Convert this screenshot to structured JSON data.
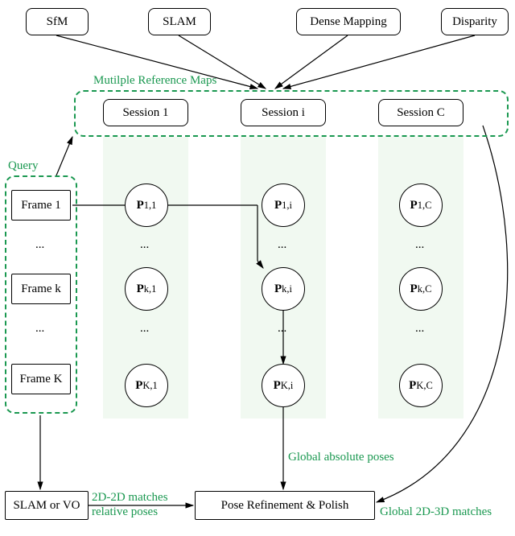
{
  "top": {
    "sfm": "SfM",
    "slam": "SLAM",
    "dense": "Dense Mapping",
    "disparity": "Disparity"
  },
  "refmaps_label": "Mutilple Reference Maps",
  "sessions": {
    "s1": "Session 1",
    "si": "Session i",
    "sc": "Session C"
  },
  "query_label": "Query",
  "frames": {
    "f1": "Frame 1",
    "fk": "Frame k",
    "fK": "Frame K",
    "el": "..."
  },
  "poses": {
    "col1": {
      "r1": "P₁,₁",
      "rk": "Pₖ,₁",
      "rK": "Pₖ̄,₁",
      "el": "..."
    },
    "coli": {
      "r1": "P₁,ᵢ",
      "rk": "Pₖ,ᵢ",
      "rK": "Pₖ̄,ᵢ",
      "el": "..."
    },
    "colc": {
      "r1": "P₁,ꜱ",
      "rk": "Pₖ,ꜱ",
      "rK": "Pₖ̄,ꜱ",
      "el": "..."
    }
  },
  "pose_raw": {
    "c1": {
      "r1": [
        "P",
        "1,1"
      ],
      "rk": [
        "P",
        "k,1"
      ],
      "rK": [
        "P",
        "K,1"
      ]
    },
    "ci": {
      "r1": [
        "P",
        "1,i"
      ],
      "rk": [
        "P",
        "k,i"
      ],
      "rK": [
        "P",
        "K,i"
      ]
    },
    "cc": {
      "r1": [
        "P",
        "1,C"
      ],
      "rk": [
        "P",
        "k,C"
      ],
      "rK": [
        "P",
        "K,C"
      ]
    }
  },
  "bottom": {
    "slamvo": "SLAM or VO",
    "refine": "Pose Refinement & Polish"
  },
  "edge_labels": {
    "global_abs": "Global absolute poses",
    "matches2d2d": "2D-2D matches",
    "relposes": "relative poses",
    "global23": "Global 2D-3D matches"
  },
  "chart_data": {
    "type": "diagram",
    "nodes": [
      {
        "id": "sfm",
        "label": "SfM",
        "kind": "source"
      },
      {
        "id": "slam",
        "label": "SLAM",
        "kind": "source"
      },
      {
        "id": "dense",
        "label": "Dense Mapping",
        "kind": "source"
      },
      {
        "id": "disparity",
        "label": "Disparity",
        "kind": "source"
      },
      {
        "id": "refmaps",
        "label": "Mutilple Reference Maps",
        "kind": "group",
        "children": [
          "s1",
          "si",
          "sc"
        ]
      },
      {
        "id": "s1",
        "label": "Session 1",
        "kind": "session"
      },
      {
        "id": "si",
        "label": "Session i",
        "kind": "session"
      },
      {
        "id": "sc",
        "label": "Session C",
        "kind": "session"
      },
      {
        "id": "query",
        "label": "Query",
        "kind": "group",
        "children": [
          "f1",
          "fk",
          "fK"
        ]
      },
      {
        "id": "f1",
        "label": "Frame 1",
        "kind": "frame"
      },
      {
        "id": "fk",
        "label": "Frame k",
        "kind": "frame"
      },
      {
        "id": "fK",
        "label": "Frame K",
        "kind": "frame"
      },
      {
        "id": "P11",
        "label": "P_{1,1}",
        "kind": "pose"
      },
      {
        "id": "Pk1",
        "label": "P_{k,1}",
        "kind": "pose"
      },
      {
        "id": "PK1",
        "label": "P_{K,1}",
        "kind": "pose"
      },
      {
        "id": "P1i",
        "label": "P_{1,i}",
        "kind": "pose"
      },
      {
        "id": "Pki",
        "label": "P_{k,i}",
        "kind": "pose"
      },
      {
        "id": "PKi",
        "label": "P_{K,i}",
        "kind": "pose"
      },
      {
        "id": "P1c",
        "label": "P_{1,C}",
        "kind": "pose"
      },
      {
        "id": "Pkc",
        "label": "P_{k,C}",
        "kind": "pose"
      },
      {
        "id": "PKc",
        "label": "P_{K,C}",
        "kind": "pose"
      },
      {
        "id": "slamvo",
        "label": "SLAM or VO",
        "kind": "process"
      },
      {
        "id": "refine",
        "label": "Pose Refinement & Polish",
        "kind": "process"
      }
    ],
    "edges": [
      {
        "from": "sfm",
        "to": "refmaps"
      },
      {
        "from": "slam",
        "to": "refmaps"
      },
      {
        "from": "dense",
        "to": "refmaps"
      },
      {
        "from": "disparity",
        "to": "refmaps"
      },
      {
        "from": "query",
        "to": "refmaps"
      },
      {
        "from": "f1",
        "to": "P1i"
      },
      {
        "from": "fk",
        "to": "Pki"
      },
      {
        "from": "Pki",
        "to": "PKi"
      },
      {
        "from": "PKi",
        "to": "refine",
        "label": "Global absolute poses"
      },
      {
        "from": "query",
        "to": "slamvo"
      },
      {
        "from": "slamvo",
        "to": "refine",
        "label": "2D-2D matches / relative poses"
      },
      {
        "from": "sc",
        "to": "refine",
        "label": "Global 2D-3D matches"
      }
    ]
  }
}
